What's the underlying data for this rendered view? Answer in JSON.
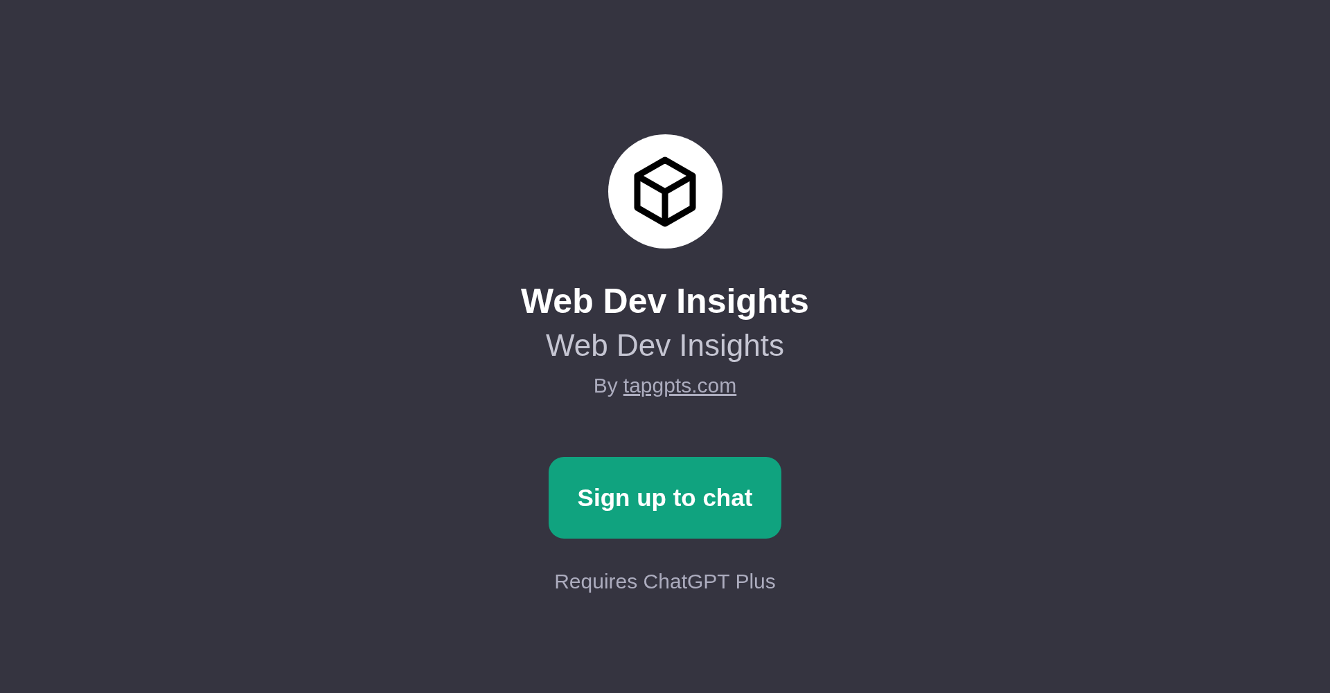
{
  "gpt": {
    "title": "Web Dev Insights",
    "description": "Web Dev Insights",
    "byline": {
      "prefix": "By",
      "link": "tapgpts.com"
    }
  },
  "action": {
    "label": "Sign up to chat"
  },
  "note": "Requires ChatGPT Plus"
}
